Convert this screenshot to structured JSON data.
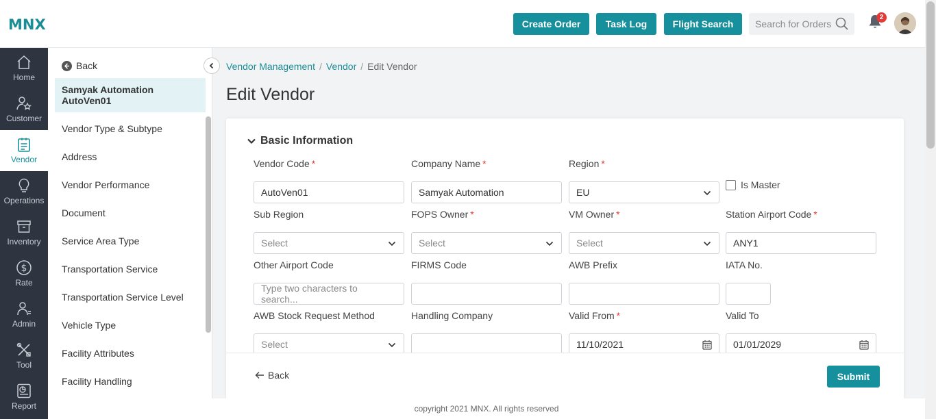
{
  "header": {
    "logo": "MNX",
    "buttons": {
      "create_order": "Create Order",
      "task_log": "Task Log",
      "flight_search": "Flight Search"
    },
    "search_placeholder": "Search for Orders",
    "notification_count": "2"
  },
  "nav": {
    "items": [
      {
        "label": "Home",
        "icon": "home-icon"
      },
      {
        "label": "Customer",
        "icon": "customer-icon"
      },
      {
        "label": "Vendor",
        "icon": "vendor-icon",
        "active": true
      },
      {
        "label": "Operations",
        "icon": "lightbulb-icon"
      },
      {
        "label": "Inventory",
        "icon": "box-icon"
      },
      {
        "label": "Rate",
        "icon": "dollar-icon"
      },
      {
        "label": "Admin",
        "icon": "admin-icon"
      },
      {
        "label": "Tool",
        "icon": "tool-icon"
      },
      {
        "label": "Report",
        "icon": "report-icon"
      }
    ]
  },
  "subnav": {
    "back_label": "Back",
    "vendor_name": "Samyak Automation AutoVen01",
    "items": [
      "Vendor Type & Subtype",
      "Address",
      "Vendor Performance",
      "Document",
      "Service Area Type",
      "Transportation Service",
      "Transportation Service Level",
      "Vehicle Type",
      "Facility Attributes",
      "Facility Handling"
    ]
  },
  "breadcrumb": {
    "level1": "Vendor Management",
    "level2": "Vendor",
    "current": "Edit Vendor"
  },
  "page_title": "Edit Vendor",
  "form": {
    "section_title": "Basic Information",
    "vendor_code": {
      "label": "Vendor Code",
      "value": "AutoVen01"
    },
    "company_name": {
      "label": "Company Name",
      "value": "Samyak Automation"
    },
    "region": {
      "label": "Region",
      "value": "EU"
    },
    "is_master": {
      "label": "Is Master",
      "checked": false
    },
    "sub_region": {
      "label": "Sub Region",
      "placeholder": "Select"
    },
    "fops_owner": {
      "label": "FOPS Owner",
      "placeholder": "Select"
    },
    "vm_owner": {
      "label": "VM Owner",
      "placeholder": "Select"
    },
    "station_airport_code": {
      "label": "Station Airport Code",
      "value": "ANY1"
    },
    "other_airport_code": {
      "label": "Other Airport Code",
      "placeholder": "Type two characters to search..."
    },
    "firms_code": {
      "label": "FIRMS Code",
      "value": ""
    },
    "awb_prefix": {
      "label": "AWB Prefix",
      "value": ""
    },
    "iata_no": {
      "label": "IATA No.",
      "value": ""
    },
    "awb_stock_request_method": {
      "label": "AWB Stock Request Method",
      "placeholder": "Select"
    },
    "handling_company": {
      "label": "Handling Company",
      "value": ""
    },
    "valid_from": {
      "label": "Valid From",
      "value": "11/10/2021"
    },
    "valid_to": {
      "label": "Valid To",
      "value": "01/01/2029"
    }
  },
  "footer": {
    "back_label": "Back",
    "submit_label": "Submit"
  },
  "copyright": "copyright 2021 MNX. All rights reserved",
  "colors": {
    "accent": "#16909c",
    "nav_bg": "#2f3441",
    "required": "#e53935"
  }
}
